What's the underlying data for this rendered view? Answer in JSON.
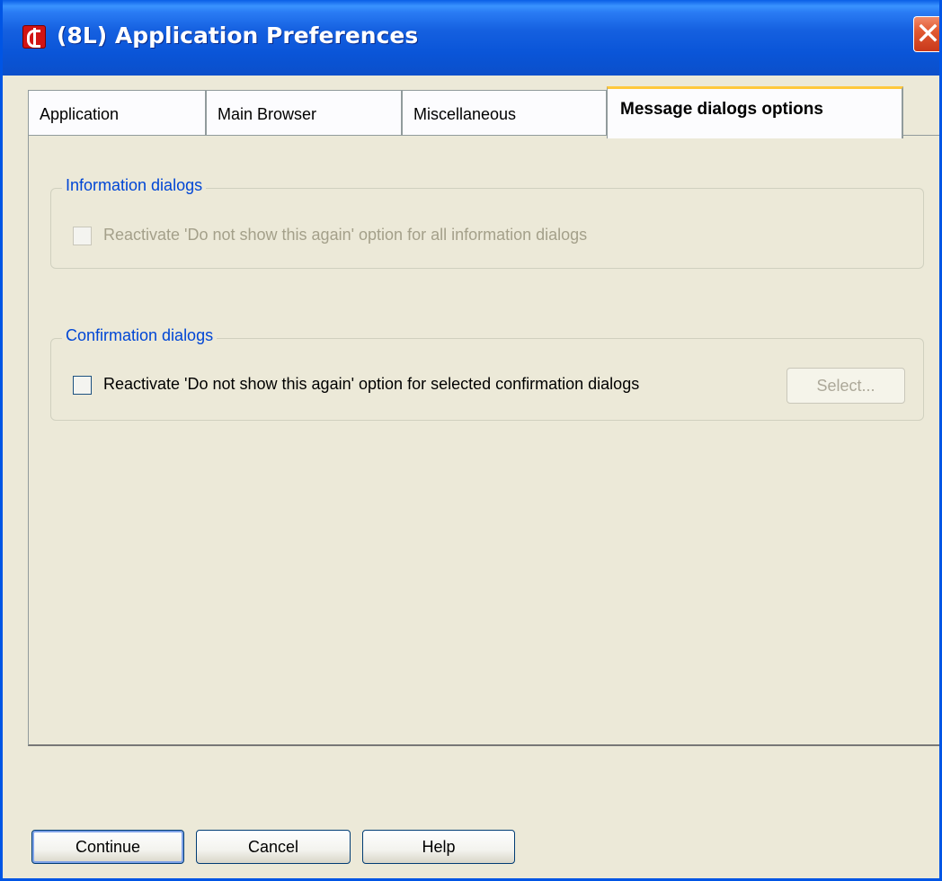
{
  "window": {
    "title": "(8L) Application Preferences",
    "close_symbol": "✕"
  },
  "tabs": [
    {
      "label": "Application",
      "active": false
    },
    {
      "label": "Main Browser",
      "active": false
    },
    {
      "label": "Miscellaneous",
      "active": false
    },
    {
      "label": "Message dialogs options",
      "active": true
    }
  ],
  "information_group": {
    "title": "Information dialogs",
    "checkbox_label": "Reactivate 'Do not show this again' option for all information dialogs",
    "checked": false,
    "enabled": false
  },
  "confirmation_group": {
    "title": "Confirmation dialogs",
    "checkbox_label": "Reactivate 'Do not show this again' option for selected confirmation dialogs",
    "checked": false,
    "enabled": true,
    "select_button_label": "Select..."
  },
  "footer": {
    "continue_label": "Continue",
    "cancel_label": "Cancel",
    "help_label": "Help"
  },
  "colors": {
    "titlebar": "#0a55d8",
    "group_title": "#0046d5",
    "active_tab_highlight": "#ffc83c",
    "close_button": "#e25a32"
  }
}
